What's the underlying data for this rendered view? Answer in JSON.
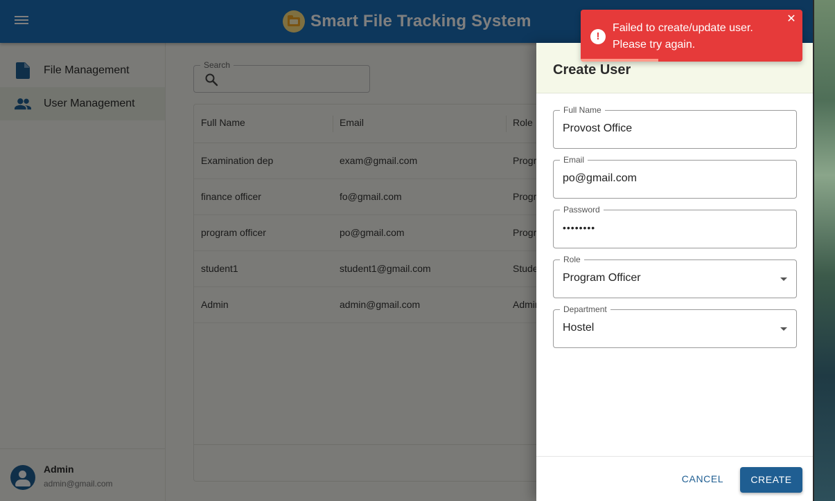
{
  "app": {
    "title": "Smart File Tracking System"
  },
  "sidebar": {
    "items": [
      {
        "label": "File Management",
        "icon": "document-icon",
        "active": false
      },
      {
        "label": "User Management",
        "icon": "people-icon",
        "active": true
      }
    ],
    "user": {
      "name": "Admin",
      "email": "admin@gmail.com"
    }
  },
  "search": {
    "label": "Search",
    "value": ""
  },
  "table": {
    "headers": [
      "Full Name",
      "Email",
      "Role"
    ],
    "rows": [
      [
        "Examination dep",
        "exam@gmail.com",
        "Progr"
      ],
      [
        "finance officer",
        "fo@gmail.com",
        "Progr"
      ],
      [
        "program officer",
        "po@gmail.com",
        "Progr"
      ],
      [
        "student1",
        "student1@gmail.com",
        "Stude"
      ],
      [
        "Admin",
        "admin@gmail.com",
        "Admin"
      ]
    ]
  },
  "drawer": {
    "title": "Create User",
    "fields": [
      {
        "label": "Full Name",
        "value": "Provost Office"
      },
      {
        "label": "Email",
        "value": "po@gmail.com"
      },
      {
        "label": "Password",
        "value": "••••••••"
      },
      {
        "label": "Role",
        "value": "Program Officer"
      },
      {
        "label": "Department",
        "value": "Hostel"
      }
    ],
    "cancel_label": "CANCEL",
    "create_label": "CREATE"
  },
  "toast": {
    "message": "Failed to create/update user. Please try again.",
    "type": "error",
    "progress": 0.35
  },
  "colors": {
    "primary": "#1b6fb8",
    "error": "#e63a3a",
    "button": "#1f5e92"
  }
}
